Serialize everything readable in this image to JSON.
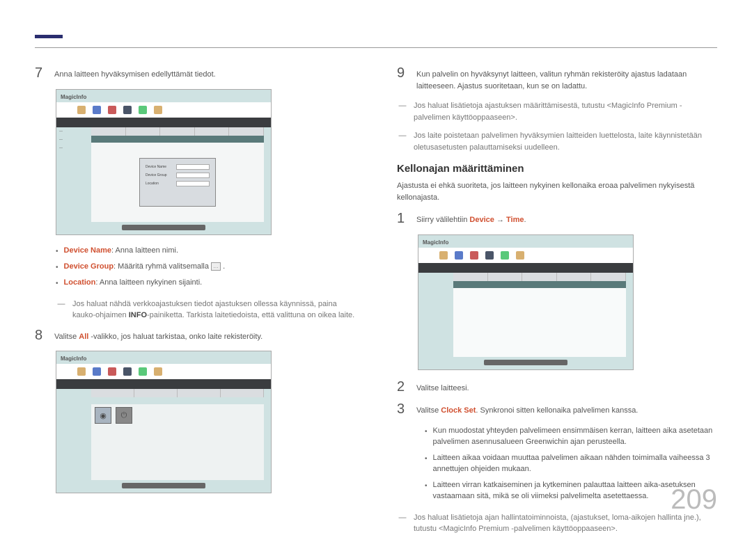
{
  "page_number": "209",
  "left": {
    "step7": {
      "num": "7",
      "text": "Anna laitteen hyväksymisen edellyttämät tiedot."
    },
    "screenshot1": {
      "logo": "MagicInfo",
      "dialog": {
        "row1_label": "Device Name",
        "row2_label": "Device Group",
        "row3_label": "Location"
      }
    },
    "bullets": [
      {
        "label": "Device Name",
        "text": ": Anna laitteen nimi."
      },
      {
        "label": "Device Group",
        "text": ": Määritä ryhmä valitsemalla "
      },
      {
        "label": "Location",
        "text": ": Anna laitteen nykyinen sijainti."
      }
    ],
    "dash_note1_a": "Jos haluat nähdä verkkoajastuksen tiedot ajastuksen ollessa käynnissä, paina kauko-ohjaimen ",
    "dash_note1_bold": "INFO",
    "dash_note1_b": "-painiketta. Tarkista laitetiedoista, että valittuna on oikea laite.",
    "step8": {
      "num": "8",
      "a": "Valitse ",
      "all": "All",
      "b": " -valikko, jos haluat tarkistaa, onko laite rekisteröity."
    },
    "screenshot2": {
      "logo": "MagicInfo"
    }
  },
  "right": {
    "step9": {
      "num": "9",
      "text": "Kun palvelin on hyväksynyt laitteen, valitun ryhmän rekisteröity ajastus ladataan laitteeseen. Ajastus suoritetaan, kun se on ladattu."
    },
    "dash_note1": "Jos haluat lisätietoja ajastuksen määrittämisestä, tutustu <MagicInfo Premium -palvelimen käyttöoppaaseen>.",
    "dash_note2": "Jos laite poistetaan palvelimen hyväksymien laitteiden luettelosta, laite käynnistetään oletusasetusten palauttamiseksi uudelleen.",
    "subsection": "Kellonajan määrittäminen",
    "intro": "Ajastusta ei ehkä suoriteta, jos laitteen nykyinen kellonaika eroaa palvelimen nykyisestä kellonajasta.",
    "step1": {
      "num": "1",
      "a": "Siirry välilehtiin ",
      "device": "Device",
      "arrow": " → ",
      "time": "Time",
      "end": "."
    },
    "screenshot3": {
      "logo": "MagicInfo"
    },
    "step2": {
      "num": "2",
      "text": "Valitse laitteesi."
    },
    "step3": {
      "num": "3",
      "a": "Valitse ",
      "clock": "Clock Set",
      "b": ". Synkronoi sitten kellonaika palvelimen kanssa."
    },
    "bullets2": [
      "Kun muodostat yhteyden palvelimeen ensimmäisen kerran, laitteen aika asetetaan palvelimen asennusalueen Greenwichin ajan perusteella.",
      "Laitteen aikaa voidaan muuttaa palvelimen aikaan nähden toimimalla vaiheessa 3 annettujen ohjeiden mukaan.",
      "Laitteen virran katkaiseminen ja kytkeminen palauttaa laitteen aika-asetuksen vastaamaan sitä, mikä se oli viimeksi palvelimelta asetettaessa."
    ],
    "dash_note3": "Jos haluat lisätietoja ajan hallintatoiminnoista, (ajastukset, loma-aikojen hallinta jne.), tutustu <MagicInfo Premium -palvelimen käyttöoppaaseen>."
  }
}
